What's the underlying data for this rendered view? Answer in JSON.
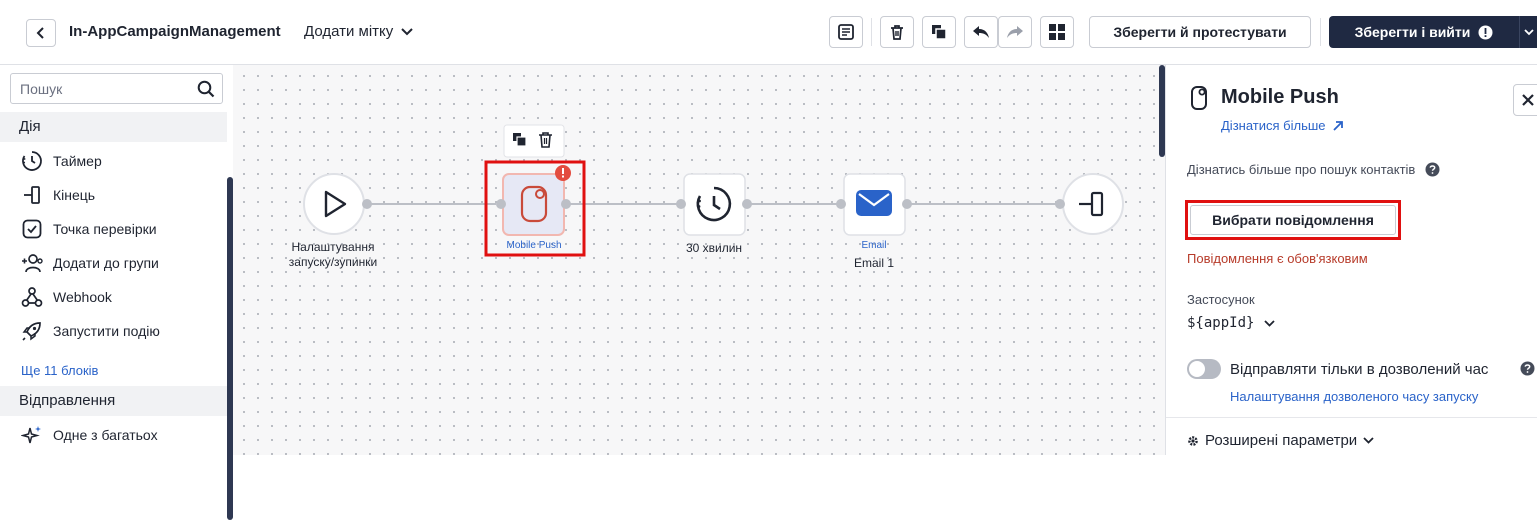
{
  "header": {
    "title": "In-AppCampaignManagement",
    "add_tag": "Додати мітку",
    "test_button": "Зберегти й протестувати",
    "save_button": "Зберегти і вийти"
  },
  "sidebar": {
    "search_placeholder": "Пошук",
    "section_actions": "Дія",
    "items": [
      {
        "label": "Таймер",
        "icon": "timer-icon"
      },
      {
        "label": "Кінець",
        "icon": "end-icon"
      },
      {
        "label": "Точка перевірки",
        "icon": "checkpoint-icon"
      },
      {
        "label": "Додати до групи",
        "icon": "add-group-icon"
      },
      {
        "label": "Webhook",
        "icon": "webhook-icon"
      },
      {
        "label": "Запустити подію",
        "icon": "rocket-icon"
      }
    ],
    "more_link": "Ще 11 блоків",
    "section_send": "Відправлення",
    "send_items": [
      {
        "label": "Одне з багатьох",
        "icon": "sparkle-icon"
      }
    ]
  },
  "canvas": {
    "nodes": [
      {
        "id": "start",
        "label": "Налаштування запуску/зупинки"
      },
      {
        "id": "mobile-push",
        "sub": "Mobile Push"
      },
      {
        "id": "timer",
        "label": "30 хвилин"
      },
      {
        "id": "email",
        "sub": "Email",
        "label": "Email 1"
      },
      {
        "id": "end"
      }
    ]
  },
  "panel": {
    "title": "Mobile Push",
    "learn_more": "Дізнатися більше",
    "contacts_text": "Дізнатись більше про пошук контактів",
    "choose_button": "Вибрати повідомлення",
    "error_text": "Повідомлення є обов'язковим",
    "app_label": "Застосунок",
    "app_value": "${appId}",
    "toggle_label": "Відправляти тільки в дозволений час",
    "time_link": "Налаштування дозволеного часу запуску",
    "advanced": "Розширені параметри"
  },
  "colors": {
    "primary_dark": "#1f2942",
    "link": "#2a63c9",
    "error": "#b73b2a",
    "highlight": "#e01010",
    "push_icon": "#c94a3a",
    "email_icon": "#2a63c9"
  }
}
